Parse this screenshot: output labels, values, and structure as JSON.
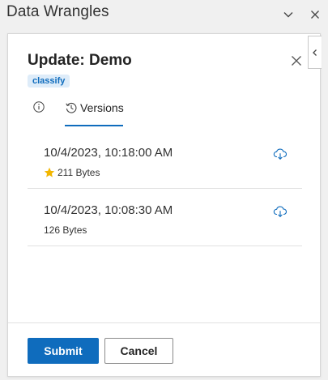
{
  "window": {
    "title": "Data Wrangles"
  },
  "dialog": {
    "title": "Update: Demo",
    "tag": "classify",
    "close_icon": "close-icon"
  },
  "tabs": [
    {
      "name": "info",
      "label": "",
      "icon": "info-icon",
      "active": false
    },
    {
      "name": "versions",
      "label": "Versions",
      "icon": "history-icon",
      "active": true
    }
  ],
  "versions": [
    {
      "date": "10/4/2023, 10:18:00 AM",
      "size": "211 Bytes",
      "starred": true
    },
    {
      "date": "10/4/2023, 10:08:30 AM",
      "size": "126 Bytes",
      "starred": false
    }
  ],
  "footer": {
    "submit_label": "Submit",
    "cancel_label": "Cancel"
  },
  "colors": {
    "accent": "#0f6cbd",
    "badge_bg": "#deecf9",
    "star": "#f2b600"
  }
}
